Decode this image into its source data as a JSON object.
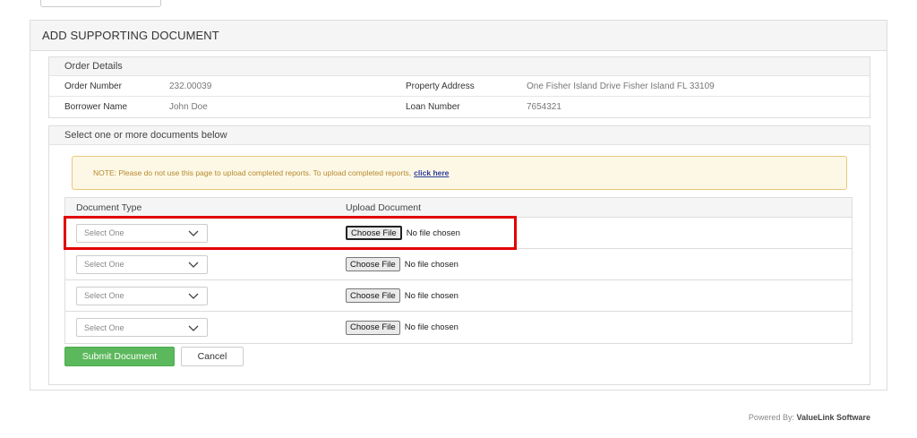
{
  "panel": {
    "title": "ADD SUPPORTING DOCUMENT"
  },
  "order_details": {
    "heading": "Order Details",
    "rows": [
      {
        "label1": "Order Number",
        "value1": "232.00039",
        "label2": "Property Address",
        "value2": "One Fisher Island Drive Fisher Island FL 33109"
      },
      {
        "label1": "Borrower Name",
        "value1": "John Doe",
        "label2": "Loan Number",
        "value2": "7654321"
      }
    ]
  },
  "documents": {
    "heading": "Select one or more documents below",
    "note_text": "NOTE: Please do not use this page to upload completed reports. To upload completed reports,",
    "note_link": "click here",
    "col_type": "Document Type",
    "col_upload": "Upload Document",
    "rows": [
      {
        "select": "Select One",
        "file_button": "Choose File",
        "file_status": "No file chosen"
      },
      {
        "select": "Select One",
        "file_button": "Choose File",
        "file_status": "No file chosen"
      },
      {
        "select": "Select One",
        "file_button": "Choose File",
        "file_status": "No file chosen"
      },
      {
        "select": "Select One",
        "file_button": "Choose File",
        "file_status": "No file chosen"
      }
    ]
  },
  "actions": {
    "submit": "Submit Document",
    "cancel": "Cancel"
  },
  "footer": {
    "prefix": "Powered By:",
    "brand": "ValueLink Software"
  },
  "colors": {
    "accent_green": "#5cb85c",
    "highlight_red": "#e10000",
    "note_bg": "#fdf8e6",
    "link": "#2a3b9e"
  },
  "icons": {
    "select_arrow": "chevron-down-icon"
  }
}
